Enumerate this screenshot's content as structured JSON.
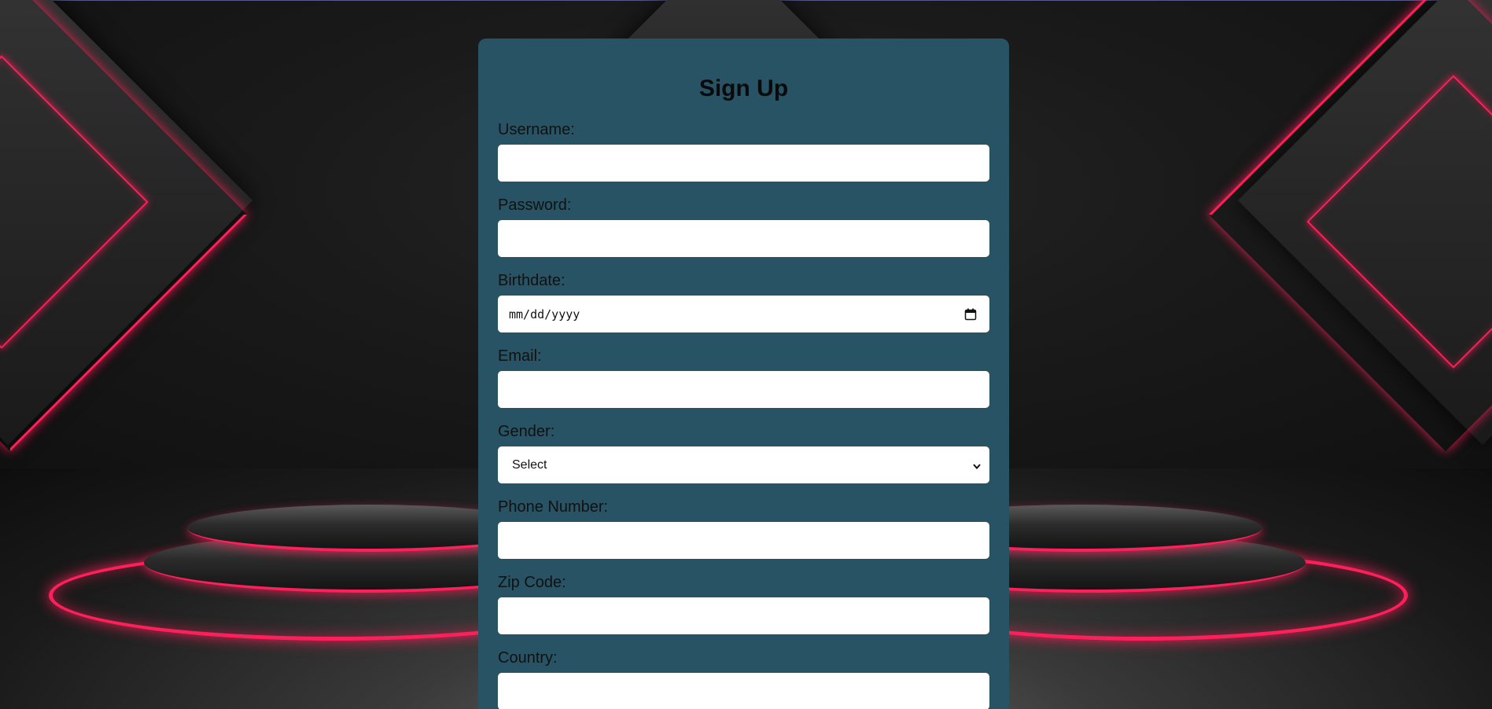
{
  "form": {
    "title": "Sign Up",
    "fields": {
      "username": {
        "label": "Username:",
        "value": ""
      },
      "password": {
        "label": "Password:",
        "value": ""
      },
      "birthdate": {
        "label": "Birthdate:",
        "placeholder": "mm/dd/yyyy"
      },
      "email": {
        "label": "Email:",
        "value": ""
      },
      "gender": {
        "label": "Gender:",
        "selected": "Select"
      },
      "phone": {
        "label": "Phone Number:",
        "value": ""
      },
      "zip": {
        "label": "Zip Code:",
        "value": ""
      },
      "country": {
        "label": "Country:",
        "value": ""
      }
    }
  },
  "icons": {
    "calendar": "calendar-icon",
    "dropdown": "chevron-down-icon"
  },
  "colors": {
    "card_background": "#275364",
    "neon_accent": "#ff1f5a",
    "input_background": "#ffffff"
  }
}
